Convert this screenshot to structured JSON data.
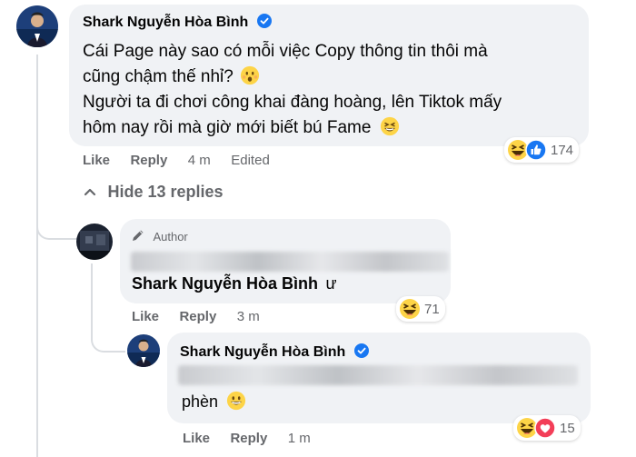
{
  "colors": {
    "bubble": "#f0f2f5",
    "secondary_text": "#65676b",
    "verified": "#1877f2",
    "heart": "#f33e58"
  },
  "comment_main": {
    "author": "Shark Nguyễn Hòa Bình",
    "line1": "Cái Page này sao có mỗi việc Copy thông tin thôi mà",
    "line2": "cũng chậm thế nhỉ?",
    "line3": "Người ta đi chơi công khai đàng hoàng, lên Tiktok mấy",
    "line4": "hôm nay rồi mà giờ mới biết bú Fame",
    "like_label": "Like",
    "reply_label": "Reply",
    "time": "4 m",
    "edited": "Edited",
    "reaction_count": "174",
    "reaction_icons": [
      "haha-icon",
      "like-icon"
    ],
    "hide_replies_label": "Hide 13 replies"
  },
  "reply_author": {
    "badge": "Author",
    "mention_name": "Shark Nguyễn Hòa Bình",
    "suffix": "ư",
    "like_label": "Like",
    "reply_label": "Reply",
    "time": "3 m",
    "reaction_count": "71",
    "reaction_icons": [
      "haha-icon"
    ]
  },
  "reply_shark": {
    "author": "Shark Nguyễn Hòa Bình",
    "text": "phèn",
    "like_label": "Like",
    "reply_label": "Reply",
    "time": "1 m",
    "reaction_count": "15",
    "reaction_icons": [
      "haha-icon",
      "love-icon"
    ]
  }
}
